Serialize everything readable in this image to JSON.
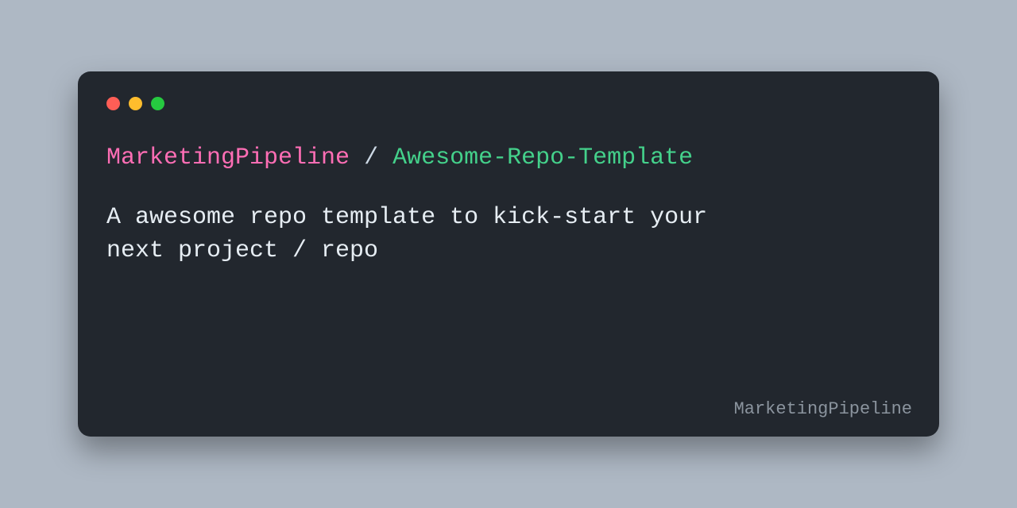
{
  "title": {
    "owner": "MarketingPipeline",
    "separator": " / ",
    "repo": "Awesome-Repo-Template"
  },
  "description": "A awesome repo template to kick-start your\nnext project / repo",
  "watermark": "MarketingPipeline",
  "icons": {
    "close": "close-icon",
    "minimize": "minimize-icon",
    "zoom": "zoom-icon"
  }
}
